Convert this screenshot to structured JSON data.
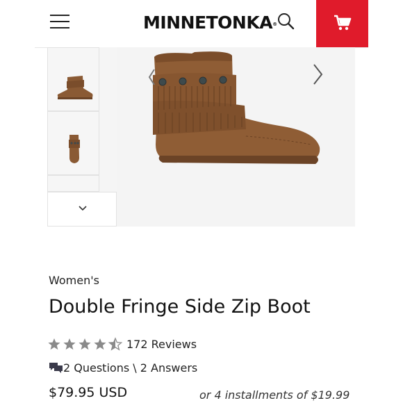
{
  "header": {
    "logo": "MINNETONKA",
    "logo_mark": "®",
    "menu_icon": "hamburger-menu-icon",
    "search_icon": "search-icon",
    "cart_icon": "shopping-cart-icon",
    "cart_color": "#e01b2b"
  },
  "gallery": {
    "prev_icon": "chevron-left-icon",
    "next_icon": "chevron-right-icon",
    "down_icon": "chevron-down-icon",
    "product_color": "#8a5a34"
  },
  "product": {
    "category": "Women's",
    "title": "Double Fringe Side Zip Boot",
    "rating": 4.5,
    "reviews": "172 Reviews",
    "qa": "2 Questions \\ 2 Answers",
    "price": "$79.95 USD",
    "installments": "or 4 installments of $19.99"
  }
}
